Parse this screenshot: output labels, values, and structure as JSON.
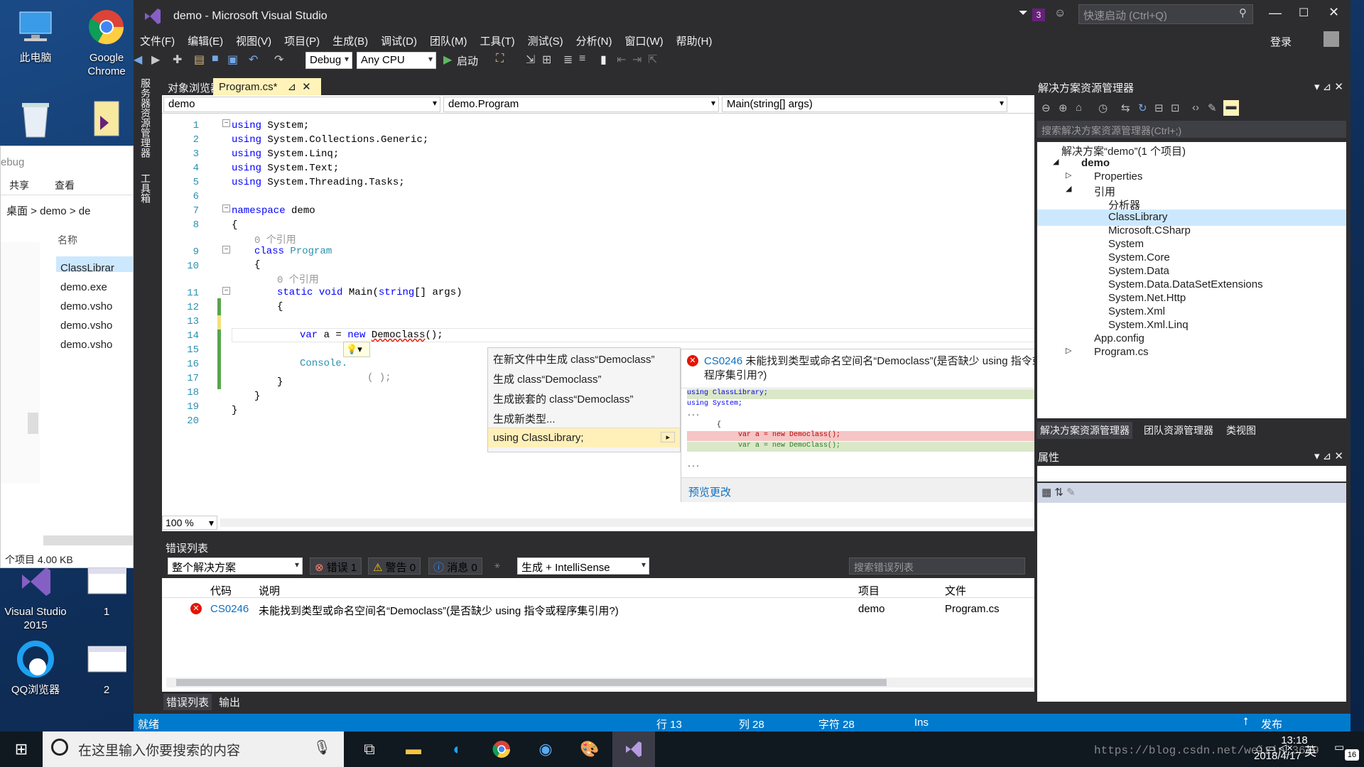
{
  "desktop": {
    "icons": [
      {
        "label": "此电脑"
      },
      {
        "label": "Google Chrome"
      },
      {
        "label": "Visual Studio 2015"
      },
      {
        "label": "1"
      },
      {
        "label": "QQ浏览器"
      },
      {
        "label": "2"
      }
    ]
  },
  "explorer": {
    "path_partial": "ebug",
    "ribbon": [
      "共享",
      "查看"
    ],
    "breadcrumb": [
      "桌面",
      "demo",
      "de"
    ],
    "column_header": "名称",
    "files": [
      "ClassLibrar",
      "demo.exe",
      "demo.vsho",
      "demo.vsho",
      "demo.vsho"
    ],
    "status": "个项目  4.00 KB"
  },
  "vs": {
    "title": "demo - Microsoft Visual Studio",
    "notification_count": "3",
    "quick_launch_placeholder": "快速启动 (Ctrl+Q)",
    "login": "登录",
    "menu": [
      "文件(F)",
      "编辑(E)",
      "视图(V)",
      "项目(P)",
      "生成(B)",
      "调试(D)",
      "团队(M)",
      "工具(T)",
      "测试(S)",
      "分析(N)",
      "窗口(W)",
      "帮助(H)"
    ],
    "toolbar": {
      "config": "Debug",
      "platform": "Any CPU",
      "start": "启动"
    },
    "side_strip": [
      "服务器资源管理器",
      "工具箱"
    ],
    "editor": {
      "tabs": [
        {
          "label": "对象浏览器"
        },
        {
          "label": "Program.cs*"
        }
      ],
      "nav": {
        "project": "demo",
        "class": "demo.Program",
        "member": "Main(string[] args)"
      },
      "zoom": "100 %",
      "lines": [
        "1",
        "2",
        "3",
        "4",
        "5",
        "6",
        "7",
        "8",
        "9",
        "10",
        "11",
        "12",
        "13",
        "14",
        "15",
        "16",
        "17",
        "18",
        "19",
        "20"
      ],
      "code": {
        "l1": "System;",
        "l2": "System.Collections.Generic;",
        "l3": "System.Linq;",
        "l4": "System.Text;",
        "l5": "System.Threading.Tasks;",
        "using_kw": "using",
        "namespace_kw": "namespace",
        "ns_name": "demo",
        "ref0": "0 个引用",
        "class_kw": "class",
        "class_name": "Program",
        "static_kw": "static",
        "void_kw": "void",
        "main": "Main(",
        "string_kw": "string",
        "args": "[] args)",
        "var_kw": "var",
        "var_rest": " a = ",
        "new_kw": "new",
        "democlass": "Democlass",
        "paren": "();",
        "console": "Console.",
        "console_tail": "( );",
        "ob": "{",
        "cb": "}"
      }
    },
    "quick_actions": {
      "items": [
        "在新文件中生成 class“Democlass”",
        "生成 class“Democlass”",
        "生成嵌套的 class“Democlass”",
        "生成新类型...",
        "using ClassLibrary;"
      ]
    },
    "preview": {
      "code": "CS0246",
      "message": "未能找到类型或命名空间名“Democlass”(是否缺少 using 指令或程序集引用?)",
      "diff": [
        "using ClassLibrary;",
        "using System;",
        "...",
        "{",
        "var a = new Democlass();",
        "var a = new DemoClass();",
        "..."
      ],
      "link": "预览更改"
    },
    "error_list": {
      "title": "错误列表",
      "scope": "整个解决方案",
      "errors": "错误 1",
      "warnings": "警告 0",
      "messages": "消息 0",
      "source": "生成 + IntelliSense",
      "search_placeholder": "搜索错误列表",
      "columns": [
        "代码",
        "说明",
        "项目",
        "文件"
      ],
      "rows": [
        {
          "code": "CS0246",
          "desc": "未能找到类型或命名空间名“Democlass”(是否缺少 using 指令或程序集引用?)",
          "project": "demo",
          "file": "Program.cs"
        }
      ],
      "bottom_tabs": [
        "错误列表",
        "输出"
      ]
    },
    "solution_explorer": {
      "title": "解决方案资源管理器",
      "search_placeholder": "搜索解决方案资源管理器(Ctrl+;)",
      "tree": [
        "解决方案“demo”(1 个项目)",
        "demo",
        "Properties",
        "引用",
        "分析器",
        "ClassLibrary",
        "Microsoft.CSharp",
        "System",
        "System.Core",
        "System.Data",
        "System.Data.DataSetExtensions",
        "System.Net.Http",
        "System.Xml",
        "System.Xml.Linq",
        "App.config",
        "Program.cs"
      ],
      "tabs": [
        "解决方案资源管理器",
        "团队资源管理器",
        "类视图"
      ]
    },
    "properties": {
      "title": "属性"
    },
    "status": {
      "ready": "就绪",
      "line": "行 13",
      "col": "列 28",
      "char": "字符 28",
      "ins": "Ins",
      "publish": "发布"
    }
  },
  "taskbar": {
    "search_placeholder": "在这里输入你要搜索的内容",
    "ime": "英",
    "time": "13:18",
    "date": "2018/4/17",
    "notif": "16",
    "watermark": "https://blog.csdn.net/weixin_3679"
  }
}
